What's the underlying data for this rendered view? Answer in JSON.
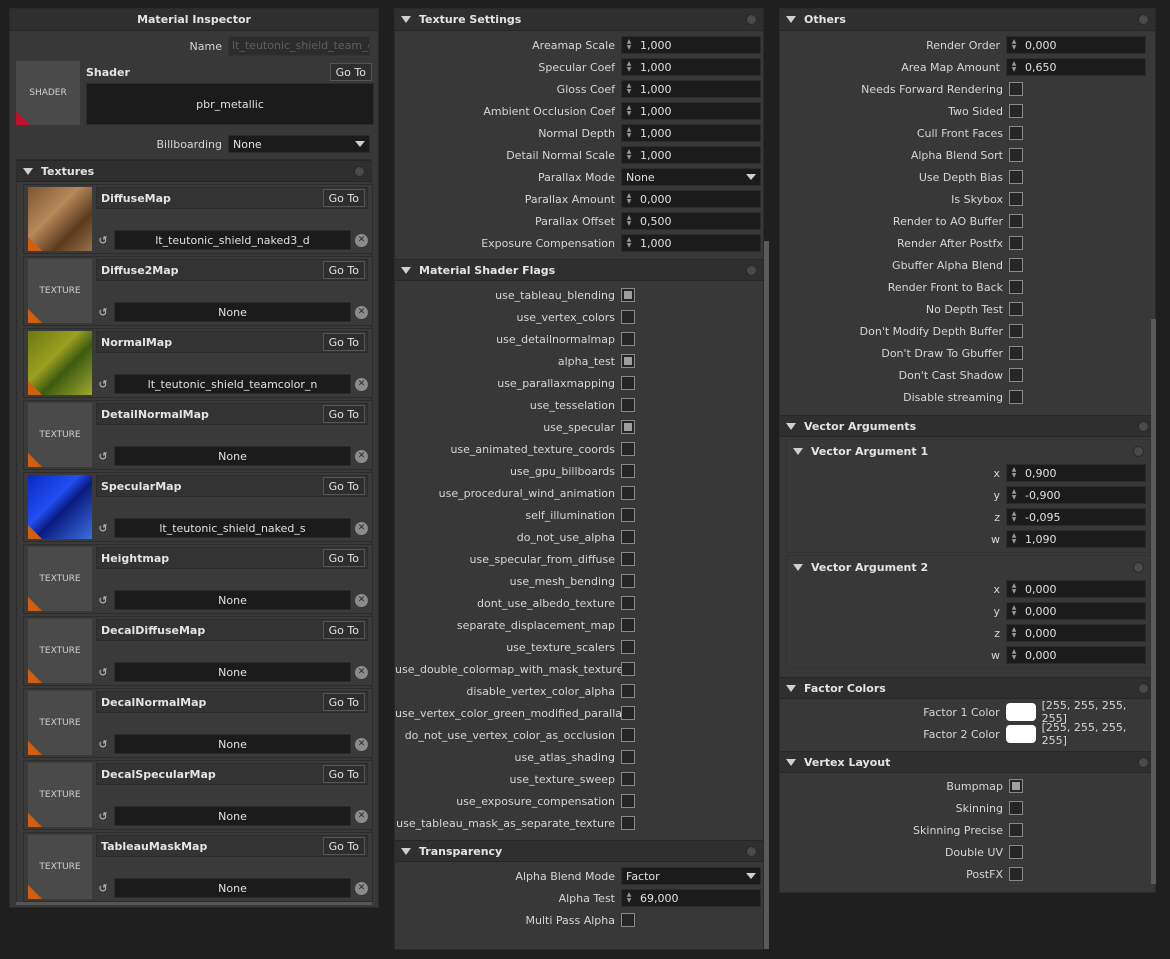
{
  "left": {
    "title": "Material Inspector",
    "name_label": "Name",
    "name_value": "lt_teutonic_shield_team_co",
    "shader_thumb": "SHADER",
    "shader_label": "Shader",
    "goto": "Go To",
    "shader_value": "pbr_metallic",
    "billboarding_label": "Billboarding",
    "billboarding_value": "None",
    "textures_title": "Textures",
    "textures": [
      {
        "label": "DiffuseMap",
        "value": "lt_teutonic_shield_naked3_d",
        "thumb": ""
      },
      {
        "label": "Diffuse2Map",
        "value": "None",
        "thumb": "TEXTURE"
      },
      {
        "label": "NormalMap",
        "value": "lt_teutonic_shield_teamcolor_n",
        "thumb": ""
      },
      {
        "label": "DetailNormalMap",
        "value": "None",
        "thumb": "TEXTURE"
      },
      {
        "label": "SpecularMap",
        "value": "lt_teutonic_shield_naked_s",
        "thumb": ""
      },
      {
        "label": "Heightmap",
        "value": "None",
        "thumb": "TEXTURE"
      },
      {
        "label": "DecalDiffuseMap",
        "value": "None",
        "thumb": "TEXTURE"
      },
      {
        "label": "DecalNormalMap",
        "value": "None",
        "thumb": "TEXTURE"
      },
      {
        "label": "DecalSpecularMap",
        "value": "None",
        "thumb": "TEXTURE"
      },
      {
        "label": "TableauMaskMap",
        "value": "None",
        "thumb": "TEXTURE"
      }
    ]
  },
  "texture_settings": {
    "title": "Texture Settings",
    "rows": [
      {
        "label": "Areamap Scale",
        "value": "1,000",
        "type": "num"
      },
      {
        "label": "Specular Coef",
        "value": "1,000",
        "type": "num"
      },
      {
        "label": "Gloss Coef",
        "value": "1,000",
        "type": "num"
      },
      {
        "label": "Ambient Occlusion Coef",
        "value": "1,000",
        "type": "num"
      },
      {
        "label": "Normal Depth",
        "value": "1,000",
        "type": "num"
      },
      {
        "label": "Detail Normal Scale",
        "value": "1,000",
        "type": "num"
      },
      {
        "label": "Parallax Mode",
        "value": "None",
        "type": "sel"
      },
      {
        "label": "Parallax Amount",
        "value": "0,000",
        "type": "num"
      },
      {
        "label": "Parallax Offset",
        "value": "0,500",
        "type": "num"
      },
      {
        "label": "Exposure Compensation",
        "value": "1,000",
        "type": "num"
      }
    ]
  },
  "shader_flags": {
    "title": "Material Shader Flags",
    "rows": [
      {
        "label": "use_tableau_blending",
        "checked": true
      },
      {
        "label": "use_vertex_colors",
        "checked": false
      },
      {
        "label": "use_detailnormalmap",
        "checked": false
      },
      {
        "label": "alpha_test",
        "checked": true
      },
      {
        "label": "use_parallaxmapping",
        "checked": false
      },
      {
        "label": "use_tesselation",
        "checked": false
      },
      {
        "label": "use_specular",
        "checked": true
      },
      {
        "label": "use_animated_texture_coords",
        "checked": false
      },
      {
        "label": "use_gpu_billboards",
        "checked": false
      },
      {
        "label": "use_procedural_wind_animation",
        "checked": false
      },
      {
        "label": "self_illumination",
        "checked": false
      },
      {
        "label": "do_not_use_alpha",
        "checked": false
      },
      {
        "label": "use_specular_from_diffuse",
        "checked": false
      },
      {
        "label": "use_mesh_bending",
        "checked": false
      },
      {
        "label": "dont_use_albedo_texture",
        "checked": false
      },
      {
        "label": "separate_displacement_map",
        "checked": false
      },
      {
        "label": "use_texture_scalers",
        "checked": false
      },
      {
        "label": "use_double_colormap_with_mask_texture",
        "checked": false
      },
      {
        "label": "disable_vertex_color_alpha",
        "checked": false
      },
      {
        "label": "use_vertex_color_green_modified_parallax",
        "checked": false
      },
      {
        "label": "do_not_use_vertex_color_as_occlusion",
        "checked": false
      },
      {
        "label": "use_atlas_shading",
        "checked": false
      },
      {
        "label": "use_texture_sweep",
        "checked": false
      },
      {
        "label": "use_exposure_compensation",
        "checked": false
      },
      {
        "label": "use_tableau_mask_as_separate_texture",
        "checked": false
      }
    ]
  },
  "transparency": {
    "title": "Transparency",
    "blend_label": "Alpha Blend Mode",
    "blend_value": "Factor",
    "alpha_test_label": "Alpha Test",
    "alpha_test_value": "69,000",
    "multipass_label": "Multi Pass Alpha",
    "multipass_checked": false
  },
  "others": {
    "title": "Others",
    "render_order_label": "Render Order",
    "render_order_value": "0,000",
    "area_map_label": "Area Map Amount",
    "area_map_value": "0,650",
    "flags": [
      {
        "label": "Needs Forward Rendering",
        "checked": false
      },
      {
        "label": "Two Sided",
        "checked": false
      },
      {
        "label": "Cull Front Faces",
        "checked": false
      },
      {
        "label": "Alpha Blend Sort",
        "checked": false
      },
      {
        "label": "Use Depth Bias",
        "checked": false
      },
      {
        "label": "Is Skybox",
        "checked": false
      },
      {
        "label": "Render to AO Buffer",
        "checked": false
      },
      {
        "label": "Render After Postfx",
        "checked": false
      },
      {
        "label": "Gbuffer Alpha Blend",
        "checked": false
      },
      {
        "label": "Render Front to Back",
        "checked": false
      },
      {
        "label": "No Depth Test",
        "checked": false
      },
      {
        "label": "Don't Modify Depth Buffer",
        "checked": false
      },
      {
        "label": "Don't Draw To Gbuffer",
        "checked": false
      },
      {
        "label": "Don't Cast Shadow",
        "checked": false
      },
      {
        "label": "Disable streaming",
        "checked": false
      }
    ]
  },
  "vector_args": {
    "title": "Vector Arguments",
    "groups": [
      {
        "title": "Vector Argument 1",
        "x": "0,900",
        "y": "-0,900",
        "z": "-0,095",
        "w": "1,090"
      },
      {
        "title": "Vector Argument 2",
        "x": "0,000",
        "y": "0,000",
        "z": "0,000",
        "w": "0,000"
      }
    ],
    "axis": {
      "x": "x",
      "y": "y",
      "z": "z",
      "w": "w"
    }
  },
  "factor_colors": {
    "title": "Factor Colors",
    "rows": [
      {
        "label": "Factor 1 Color",
        "value": "[255, 255, 255, 255]",
        "color": "#ffffff"
      },
      {
        "label": "Factor 2 Color",
        "value": "[255, 255, 255, 255]",
        "color": "#ffffff"
      }
    ]
  },
  "vertex_layout": {
    "title": "Vertex Layout",
    "rows": [
      {
        "label": "Bumpmap",
        "checked": true
      },
      {
        "label": "Skinning",
        "checked": false
      },
      {
        "label": "Skinning Precise",
        "checked": false
      },
      {
        "label": "Double UV",
        "checked": false
      },
      {
        "label": "PostFX",
        "checked": false
      }
    ]
  },
  "theme": {
    "accent": "#d06010",
    "panel": "#383838",
    "field": "#1b1b1b"
  }
}
